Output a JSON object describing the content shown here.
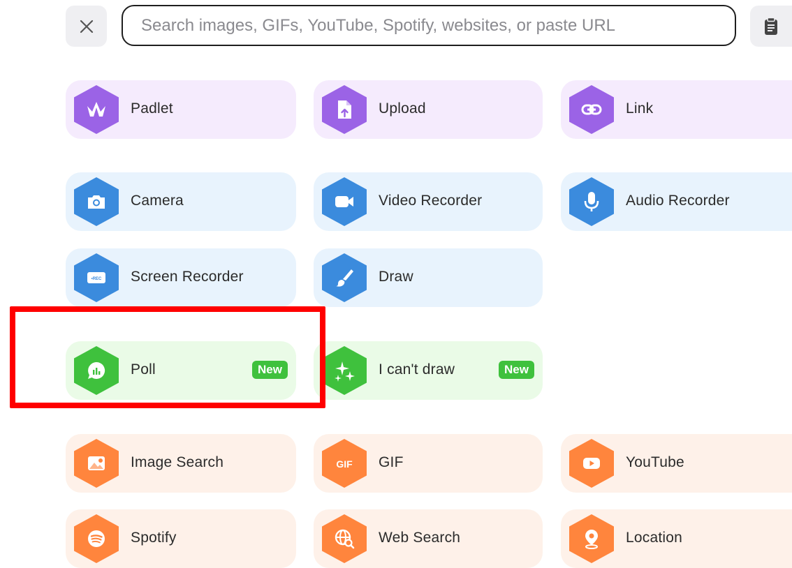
{
  "search": {
    "placeholder": "Search images, GIFs, YouTube, Spotify, websites, or paste URL",
    "value": ""
  },
  "icons": {
    "close": "close-icon",
    "paste": "clipboard-icon"
  },
  "colors": {
    "purple": "#9b63e6",
    "blue": "#3b8bdd",
    "green": "#3fc13d",
    "orange": "#ff853d",
    "highlight": "#ff0000"
  },
  "tiles": {
    "padlet": {
      "label": "Padlet",
      "icon": "padlet-bird-icon"
    },
    "upload": {
      "label": "Upload",
      "icon": "upload-file-icon"
    },
    "link": {
      "label": "Link",
      "icon": "link-icon"
    },
    "camera": {
      "label": "Camera",
      "icon": "camera-icon"
    },
    "video_recorder": {
      "label": "Video Recorder",
      "icon": "video-camera-icon"
    },
    "audio_recorder": {
      "label": "Audio Recorder",
      "icon": "microphone-icon"
    },
    "screen_recorder": {
      "label": "Screen Recorder",
      "icon": "screen-rec-icon",
      "icon_text": "•REC"
    },
    "draw": {
      "label": "Draw",
      "icon": "paintbrush-icon"
    },
    "poll": {
      "label": "Poll",
      "icon": "poll-chat-icon",
      "badge": "New"
    },
    "i_cant_draw": {
      "label": "I can't draw",
      "icon": "sparkles-icon",
      "badge": "New"
    },
    "image_search": {
      "label": "Image Search",
      "icon": "image-search-icon"
    },
    "gif": {
      "label": "GIF",
      "icon": "gif-icon",
      "icon_text": "GIF"
    },
    "youtube": {
      "label": "YouTube",
      "icon": "youtube-play-icon"
    },
    "spotify": {
      "label": "Spotify",
      "icon": "spotify-icon"
    },
    "web_search": {
      "label": "Web Search",
      "icon": "globe-search-icon"
    },
    "location": {
      "label": "Location",
      "icon": "location-pin-icon"
    }
  }
}
